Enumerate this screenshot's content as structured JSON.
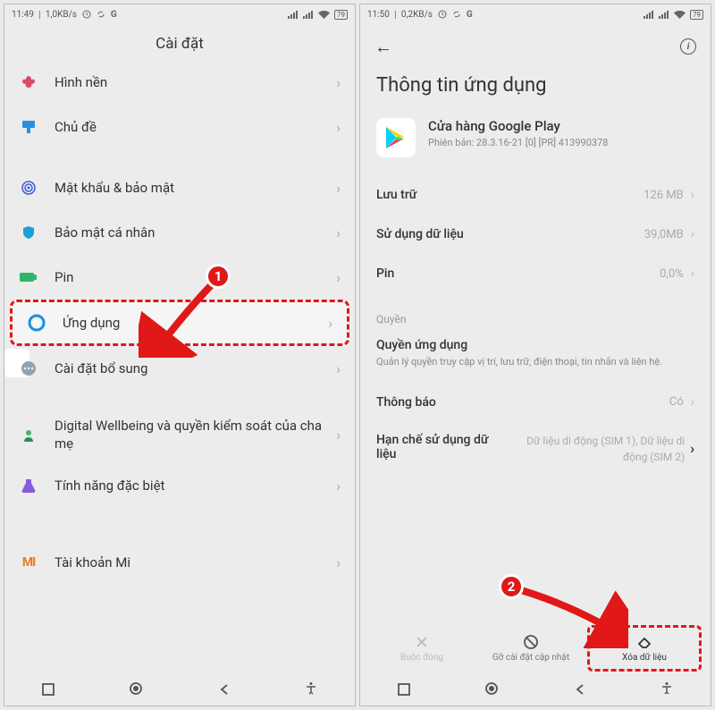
{
  "screen1": {
    "status": {
      "time": "11:49",
      "net": "1,0KB/s",
      "batt": "79"
    },
    "title": "Cài đặt",
    "rows": [
      {
        "label": "Hình nền"
      },
      {
        "label": "Chủ đề"
      },
      {
        "label": "Mật khẩu & bảo mật"
      },
      {
        "label": "Bảo mật cá nhân"
      },
      {
        "label": "Pin"
      },
      {
        "label": "Ứng dụng"
      },
      {
        "label": "Cài đặt bổ sung"
      },
      {
        "label": "Digital Wellbeing và quyền kiểm soát của cha mẹ"
      },
      {
        "label": "Tính năng đặc biệt"
      },
      {
        "label": "Tài khoản Mi"
      }
    ],
    "anno_num": "1"
  },
  "screen2": {
    "status": {
      "time": "11:50",
      "net": "0,2KB/s",
      "batt": "79"
    },
    "title": "Thông tin ứng dụng",
    "app": {
      "name": "Cửa hàng Google Play",
      "version_label": "Phiên bản: 28.3.16-21 [0] [PR] 413990378"
    },
    "stats": [
      {
        "k": "Lưu trữ",
        "v": "126 MB"
      },
      {
        "k": "Sử dụng dữ liệu",
        "v": "39,0MB"
      },
      {
        "k": "Pin",
        "v": "0,0%"
      }
    ],
    "perm_head": "Quyền",
    "perm": {
      "title": "Quyền ứng dụng",
      "desc": "Quản lý quyền truy cập vị trí, lưu trữ, điện thoại, tin nhắn và liên hệ."
    },
    "notif": {
      "k": "Thông báo",
      "v": "Có"
    },
    "limit": {
      "k": "Hạn chế sử dụng dữ liệu",
      "v": "Dữ liệu di động (SIM 1), Dữ liệu di động (SIM 2)"
    },
    "actions": [
      {
        "label": "Buộc đóng"
      },
      {
        "label": "Gỡ cài đặt cập nhật"
      },
      {
        "label": "Xóa dữ liệu"
      }
    ],
    "anno_num": "2"
  }
}
